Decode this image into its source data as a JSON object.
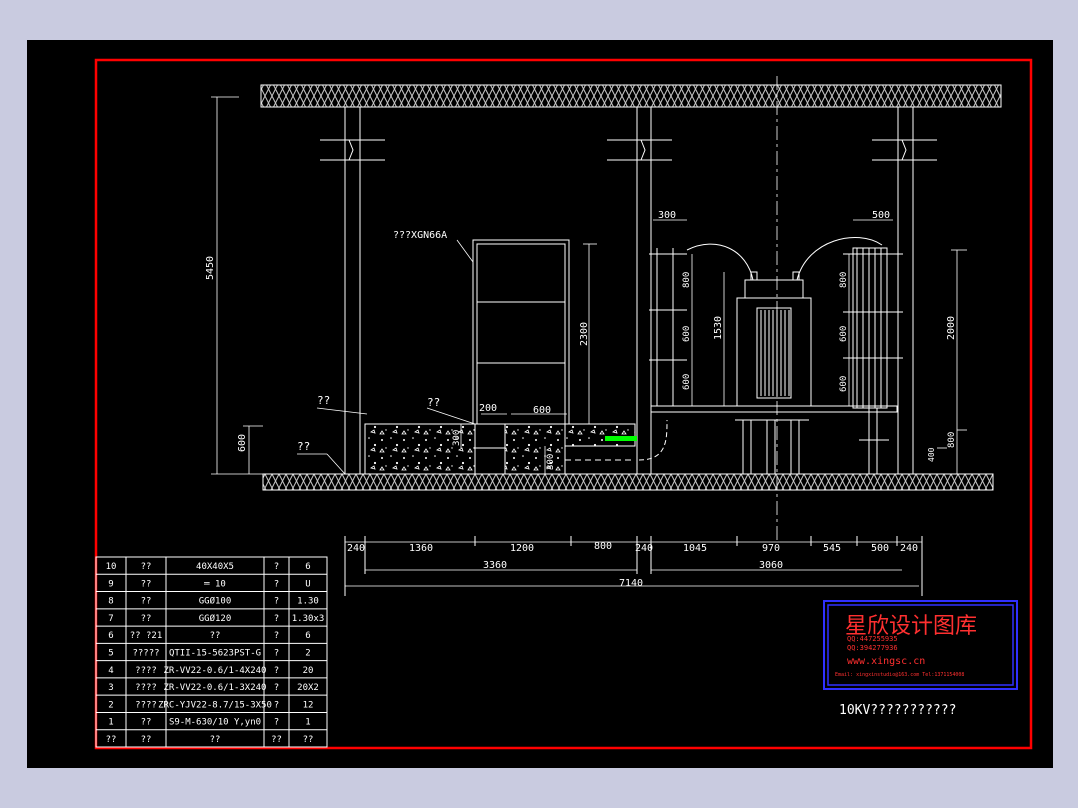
{
  "colors": {
    "background": "#c9cbe0",
    "paper": "#000000",
    "frame": "#ff0000",
    "lines": "#ffffff",
    "hatch": "#c8c8c8",
    "accent": "#00ff00",
    "stamp_border": "#3030ff",
    "stamp_text": "#ff3030"
  },
  "drawing": {
    "title": "10KV???????????",
    "labels": {
      "cabinet": "???XGN66A",
      "left_note": "??",
      "trench_note": "??",
      "floor_note": "??"
    },
    "dims": {
      "height_total": "5450",
      "height_left": "600",
      "cabinet_h": "2300",
      "cable_depth": "300",
      "trench_w": "200",
      "trench2_w": "600",
      "pit_depth": "300",
      "bracket_w_left": "300",
      "bracket_w_right": "500",
      "left_v1": "800",
      "left_v2": "600",
      "left_v3": "600",
      "transformer_h": "1530",
      "right_v1": "800",
      "right_v2": "600",
      "right_v3": "600",
      "right_h2000": "2000",
      "right_h800": "800",
      "right_h400": "400"
    },
    "bottom_dims": [
      "240",
      "1360",
      "1200",
      "800",
      "240",
      "1045",
      "970",
      "545",
      "500",
      "240"
    ],
    "sub_dims": [
      "3360",
      "3060"
    ],
    "total_dim": "7140"
  },
  "table": {
    "rows": [
      [
        "10",
        "??",
        "40X40X5",
        "?",
        "6"
      ],
      [
        "9",
        "??",
        "═ 10",
        "?",
        "U"
      ],
      [
        "8",
        "??",
        "GGØ100",
        "?",
        "1.30"
      ],
      [
        "7",
        "??",
        "GGØ120",
        "?",
        "1.30x3"
      ],
      [
        "6",
        "?? ?21",
        "??",
        "?",
        "6"
      ],
      [
        "5",
        "?????",
        "QTII-15-5623PST-G",
        "?",
        "2"
      ],
      [
        "4",
        "????",
        "ZR-VV22-0.6/1-4X240",
        "?",
        "20"
      ],
      [
        "3",
        "????",
        "ZR-VV22-0.6/1-3X240",
        "?",
        "20X2"
      ],
      [
        "2",
        "????",
        "ZRC-YJV22-8.7/15-3X50",
        "?",
        "12"
      ],
      [
        "1",
        "??",
        "S9-M-630/10 Y,yn0",
        "?",
        "1"
      ],
      [
        "??",
        "??",
        "??",
        "??",
        "??"
      ]
    ]
  },
  "stamp": {
    "title": "星欣设计图库",
    "qq1": "QQ:447255935",
    "qq2": "QQ:394277936",
    "url": "www.xingsc.cn",
    "email": "Email: xingxinstudio@163.com  Tel:1371154008"
  }
}
